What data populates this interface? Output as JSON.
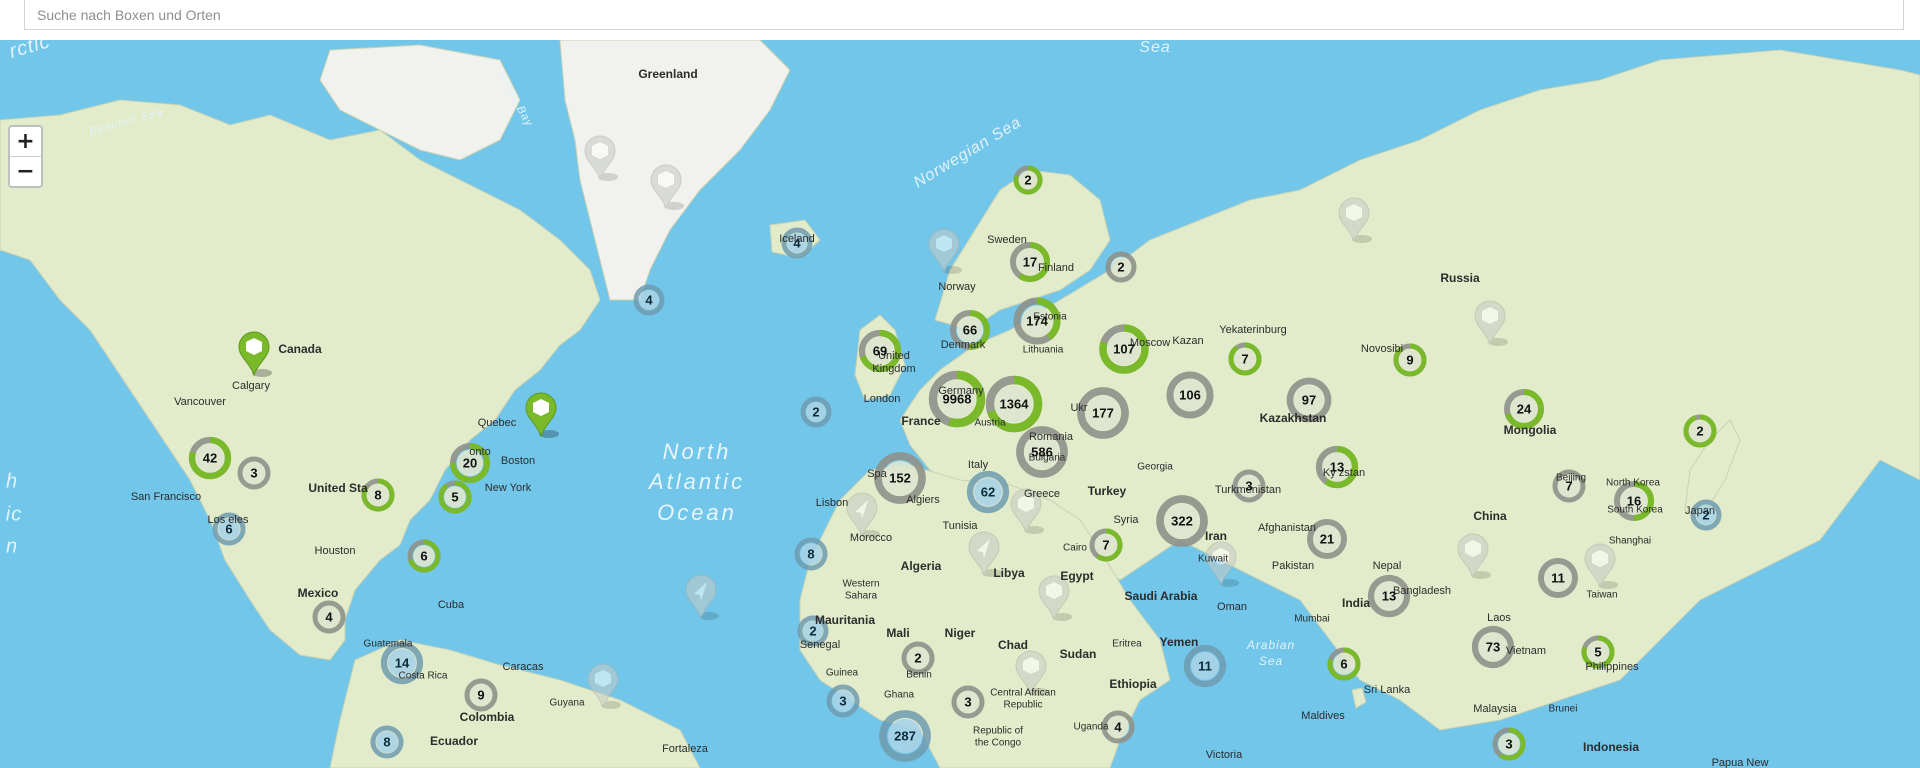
{
  "search": {
    "placeholder": "Suche nach Boxen und Orten"
  },
  "zoom": {
    "in_label": "+",
    "out_label": "−"
  },
  "colors": {
    "water": "#71c6ea",
    "land": "#e2ebca",
    "ice": "#f1f1ed",
    "active": "#7ab929",
    "inactive": "#8f9189",
    "old": "#6f9bb0"
  },
  "map_labels": [
    {
      "id": "greenland",
      "text": "Greenland"
    },
    {
      "id": "canada",
      "text": "Canada"
    },
    {
      "id": "calgary",
      "text": "Calgary"
    },
    {
      "id": "vancouver",
      "text": "Vancouver"
    },
    {
      "id": "quebec",
      "text": "Quebec"
    },
    {
      "id": "toronto",
      "text": "onto"
    },
    {
      "id": "boston",
      "text": "Boston"
    },
    {
      "id": "new-york",
      "text": "New York"
    },
    {
      "id": "united-states",
      "text": "United Sta"
    },
    {
      "id": "san-francisco",
      "text": "San Francisco"
    },
    {
      "id": "los-angeles",
      "text": "Los   eles"
    },
    {
      "id": "houston",
      "text": "Houston"
    },
    {
      "id": "mexico",
      "text": "Mexico"
    },
    {
      "id": "cuba",
      "text": "Cuba"
    },
    {
      "id": "guatemala",
      "text": "Guatemala"
    },
    {
      "id": "costa-rica",
      "text": "Costa Rica"
    },
    {
      "id": "caracas",
      "text": "Caracas"
    },
    {
      "id": "colombia",
      "text": "Colombia"
    },
    {
      "id": "guyana",
      "text": "Guyana"
    },
    {
      "id": "ecuador",
      "text": "Ecuador"
    },
    {
      "id": "fortaleza",
      "text": "Fortaleza"
    },
    {
      "id": "north-atlantic-1",
      "text": "North"
    },
    {
      "id": "north-atlantic-2",
      "text": "Atlantic"
    },
    {
      "id": "north-atlantic-3",
      "text": "Ocean"
    },
    {
      "id": "iceland",
      "text": "Iceland"
    },
    {
      "id": "norway",
      "text": "Norway"
    },
    {
      "id": "sweden",
      "text": "Sweden"
    },
    {
      "id": "finland",
      "text": "Finland"
    },
    {
      "id": "estonia",
      "text": "Estonia"
    },
    {
      "id": "denmark",
      "text": "Denmark"
    },
    {
      "id": "lithuania",
      "text": "Lithuania"
    },
    {
      "id": "united-kingdom-1",
      "text": "United"
    },
    {
      "id": "united-kingdom-2",
      "text": "Kingdom"
    },
    {
      "id": "london",
      "text": "London"
    },
    {
      "id": "germany",
      "text": "Germany"
    },
    {
      "id": "france",
      "text": "France"
    },
    {
      "id": "austria",
      "text": "Austria"
    },
    {
      "id": "ukraine",
      "text": "Ukr"
    },
    {
      "id": "romania",
      "text": "Romania"
    },
    {
      "id": "bulgaria",
      "text": "Bulgaria"
    },
    {
      "id": "italy",
      "text": "Italy"
    },
    {
      "id": "spain",
      "text": "Spa"
    },
    {
      "id": "lisbon",
      "text": "Lisbon"
    },
    {
      "id": "algiers",
      "text": "Algiers"
    },
    {
      "id": "greece",
      "text": "Greece"
    },
    {
      "id": "turkey",
      "text": "Turkey"
    },
    {
      "id": "georgia",
      "text": "Georgia"
    },
    {
      "id": "tunisia",
      "text": "Tunisia"
    },
    {
      "id": "morocco",
      "text": "Morocco"
    },
    {
      "id": "algeria",
      "text": "Algeria"
    },
    {
      "id": "libya",
      "text": "Libya"
    },
    {
      "id": "egypt",
      "text": "Egypt"
    },
    {
      "id": "western-sahara-1",
      "text": "Western"
    },
    {
      "id": "western-sahara-2",
      "text": "Sahara"
    },
    {
      "id": "mauritania",
      "text": "Mauritania"
    },
    {
      "id": "mali",
      "text": "Mali"
    },
    {
      "id": "niger",
      "text": "Niger"
    },
    {
      "id": "chad",
      "text": "Chad"
    },
    {
      "id": "sudan",
      "text": "Sudan"
    },
    {
      "id": "eritrea",
      "text": "Eritrea"
    },
    {
      "id": "ethiopia",
      "text": "Ethiopia"
    },
    {
      "id": "senegal",
      "text": "Senegal"
    },
    {
      "id": "guinea",
      "text": "Guinea"
    },
    {
      "id": "benin",
      "text": "Benin"
    },
    {
      "id": "ghana",
      "text": "Ghana"
    },
    {
      "id": "car-1",
      "text": "Central African"
    },
    {
      "id": "car-2",
      "text": "Republic"
    },
    {
      "id": "congo-1",
      "text": "Republic of"
    },
    {
      "id": "congo-2",
      "text": "the Congo"
    },
    {
      "id": "uganda",
      "text": "Uganda"
    },
    {
      "id": "victoria",
      "text": "Victoria"
    },
    {
      "id": "saudi-arabia",
      "text": "Saudi Arabia"
    },
    {
      "id": "yemen",
      "text": "Yemen"
    },
    {
      "id": "oman",
      "text": "Oman"
    },
    {
      "id": "kuwait",
      "text": "Kuwait"
    },
    {
      "id": "syria",
      "text": "Syria"
    },
    {
      "id": "cairo",
      "text": "Cairo"
    },
    {
      "id": "iran",
      "text": "Iran"
    },
    {
      "id": "moscow",
      "text": "Moscow"
    },
    {
      "id": "kazan",
      "text": "Kazan"
    },
    {
      "id": "yekaterinburg",
      "text": "Yekaterinburg"
    },
    {
      "id": "novosibirsk",
      "text": "Novosibi"
    },
    {
      "id": "russia",
      "text": "Russia"
    },
    {
      "id": "kazakhstan",
      "text": "Kazakhstan"
    },
    {
      "id": "turkmenistan",
      "text": "Turkmenistan"
    },
    {
      "id": "kyrgyzstan",
      "text": "Ky  zstan"
    },
    {
      "id": "afghanistan",
      "text": "Afghanistan"
    },
    {
      "id": "pakistan",
      "text": "Pakistan"
    },
    {
      "id": "nepal",
      "text": "Nepal"
    },
    {
      "id": "india",
      "text": "India"
    },
    {
      "id": "bangladesh",
      "text": "Bangladesh"
    },
    {
      "id": "mumbai",
      "text": "Mumbai"
    },
    {
      "id": "sri-lanka",
      "text": "Sri Lanka"
    },
    {
      "id": "maldives",
      "text": "Maldives"
    },
    {
      "id": "mongolia",
      "text": "Mongolia"
    },
    {
      "id": "china",
      "text": "China"
    },
    {
      "id": "beijing",
      "text": "Beijing"
    },
    {
      "id": "north-korea",
      "text": "North Korea"
    },
    {
      "id": "south-korea",
      "text": "South Korea"
    },
    {
      "id": "japan",
      "text": "Japan"
    },
    {
      "id": "shanghai",
      "text": "Shanghai"
    },
    {
      "id": "taiwan",
      "text": "Taiwan"
    },
    {
      "id": "laos",
      "text": "Laos"
    },
    {
      "id": "vietnam",
      "text": "Vietnam"
    },
    {
      "id": "philippines",
      "text": "Philippines"
    },
    {
      "id": "malaysia",
      "text": "Malaysia"
    },
    {
      "id": "brunei",
      "text": "Brunei"
    },
    {
      "id": "indonesia",
      "text": "Indonesia"
    },
    {
      "id": "papua",
      "text": "Papua New"
    },
    {
      "id": "norwegian-sea",
      "text": "Norwegian Sea"
    },
    {
      "id": "beaufort-sea",
      "text": "Beaufort Sea"
    },
    {
      "id": "baffin-bay",
      "text": "Baffin Bay"
    },
    {
      "id": "arabian-sea-1",
      "text": "Arabian"
    },
    {
      "id": "arabian-sea-2",
      "text": "Sea"
    },
    {
      "id": "top-sea",
      "text": "Sea"
    },
    {
      "id": "arctic-left",
      "text": "rctic"
    },
    {
      "id": "edge-h",
      "text": "h"
    },
    {
      "id": "edge-ic",
      "text": "ic"
    },
    {
      "id": "edge-n",
      "text": "n"
    }
  ],
  "clusters": [
    {
      "id": "c1",
      "count": "2",
      "color": "active"
    },
    {
      "id": "c2",
      "count": "4",
      "color": "old"
    },
    {
      "id": "c3",
      "count": "4",
      "color": "old"
    },
    {
      "id": "c4",
      "count": "17",
      "color": "active"
    },
    {
      "id": "c5",
      "count": "2",
      "color": "inactive"
    },
    {
      "id": "c6",
      "count": "66",
      "color": "active"
    },
    {
      "id": "c7",
      "count": "174",
      "color": "active"
    },
    {
      "id": "c8",
      "count": "69",
      "color": "active"
    },
    {
      "id": "c9",
      "count": "107",
      "color": "active"
    },
    {
      "id": "c10",
      "count": "7",
      "color": "active"
    },
    {
      "id": "c11",
      "count": "9",
      "color": "active"
    },
    {
      "id": "c12",
      "count": "2",
      "color": "old"
    },
    {
      "id": "c13",
      "count": "9968",
      "color": "active"
    },
    {
      "id": "c14",
      "count": "1364",
      "color": "active"
    },
    {
      "id": "c15",
      "count": "177",
      "color": "inactive"
    },
    {
      "id": "c16",
      "count": "106",
      "color": "inactive"
    },
    {
      "id": "c17",
      "count": "97",
      "color": "inactive"
    },
    {
      "id": "c18",
      "count": "24",
      "color": "active"
    },
    {
      "id": "c19",
      "count": "2",
      "color": "active"
    },
    {
      "id": "c20",
      "count": "42",
      "color": "active"
    },
    {
      "id": "c21",
      "count": "3",
      "color": "inactive"
    },
    {
      "id": "c22",
      "count": "20",
      "color": "active"
    },
    {
      "id": "c23",
      "count": "8",
      "color": "active"
    },
    {
      "id": "c24",
      "count": "5",
      "color": "active"
    },
    {
      "id": "c25",
      "count": "6",
      "color": "old"
    },
    {
      "id": "c26",
      "count": "586",
      "color": "inactive"
    },
    {
      "id": "c27",
      "count": "152",
      "color": "inactive"
    },
    {
      "id": "c28",
      "count": "62",
      "color": "old"
    },
    {
      "id": "c29",
      "count": "13",
      "color": "active"
    },
    {
      "id": "c30",
      "count": "3",
      "color": "inactive"
    },
    {
      "id": "c31",
      "count": "7",
      "color": "inactive"
    },
    {
      "id": "c32",
      "count": "16",
      "color": "active"
    },
    {
      "id": "c33",
      "count": "2",
      "color": "old"
    },
    {
      "id": "c34",
      "count": "322",
      "color": "inactive"
    },
    {
      "id": "c35",
      "count": "21",
      "color": "inactive"
    },
    {
      "id": "c36",
      "count": "7",
      "color": "active"
    },
    {
      "id": "c37",
      "count": "8",
      "color": "old"
    },
    {
      "id": "c38",
      "count": "6",
      "color": "active"
    },
    {
      "id": "c39",
      "count": "11",
      "color": "inactive"
    },
    {
      "id": "c40",
      "count": "13",
      "color": "inactive"
    },
    {
      "id": "c41",
      "count": "4",
      "color": "inactive"
    },
    {
      "id": "c42",
      "count": "2",
      "color": "old"
    },
    {
      "id": "c43",
      "count": "2",
      "color": "inactive"
    },
    {
      "id": "c44",
      "count": "73",
      "color": "inactive"
    },
    {
      "id": "c45",
      "count": "5",
      "color": "active"
    },
    {
      "id": "c46",
      "count": "14",
      "color": "old"
    },
    {
      "id": "c47",
      "count": "9",
      "color": "inactive"
    },
    {
      "id": "c48",
      "count": "11",
      "color": "old"
    },
    {
      "id": "c49",
      "count": "6",
      "color": "active"
    },
    {
      "id": "c50",
      "count": "3",
      "color": "old"
    },
    {
      "id": "c51",
      "count": "3",
      "color": "inactive"
    },
    {
      "id": "c52",
      "count": "287",
      "color": "old"
    },
    {
      "id": "c53",
      "count": "4",
      "color": "inactive"
    },
    {
      "id": "c54",
      "count": "8",
      "color": "old"
    },
    {
      "id": "c55",
      "count": "3",
      "color": "active"
    }
  ],
  "markers": [
    {
      "id": "m1",
      "kind": "box",
      "state": "active"
    },
    {
      "id": "m2",
      "kind": "box",
      "state": "active"
    },
    {
      "id": "m3",
      "kind": "box",
      "state": "faded"
    },
    {
      "id": "m4",
      "kind": "box",
      "state": "faded"
    },
    {
      "id": "m5",
      "kind": "box",
      "state": "faded"
    },
    {
      "id": "m6",
      "kind": "box",
      "state": "faded"
    },
    {
      "id": "m7",
      "kind": "box",
      "state": "faded"
    },
    {
      "id": "m8",
      "kind": "box",
      "state": "faded"
    },
    {
      "id": "m9",
      "kind": "box",
      "state": "faded"
    },
    {
      "id": "m10",
      "kind": "box",
      "state": "faded"
    },
    {
      "id": "m11",
      "kind": "box",
      "state": "faded"
    },
    {
      "id": "m12",
      "kind": "box",
      "state": "faded"
    },
    {
      "id": "m13",
      "kind": "box",
      "state": "faded"
    },
    {
      "id": "m14",
      "kind": "rocket",
      "state": "faded"
    },
    {
      "id": "m15",
      "kind": "rocket",
      "state": "faded"
    },
    {
      "id": "m16",
      "kind": "rocket",
      "state": "faded"
    },
    {
      "id": "m17",
      "kind": "box",
      "state": "faded"
    }
  ]
}
